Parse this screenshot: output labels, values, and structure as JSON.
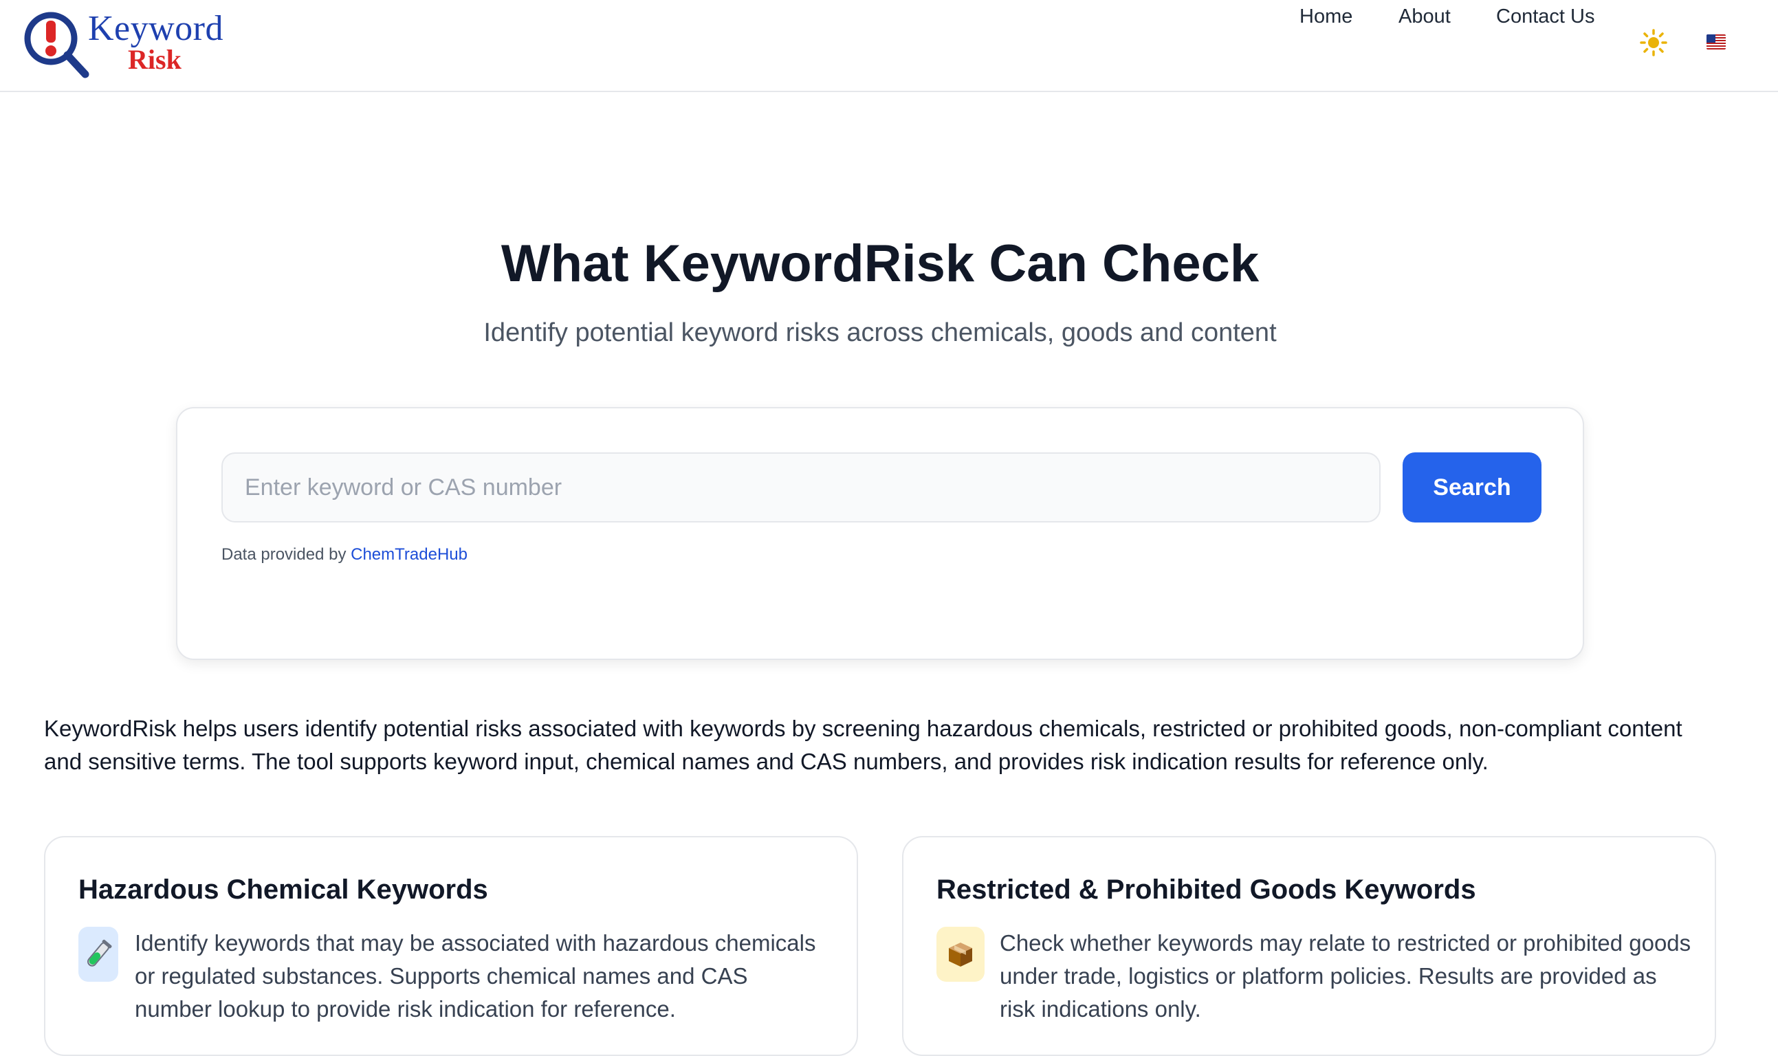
{
  "logo": {
    "line1": "Keyword",
    "line2": "Risk"
  },
  "nav": {
    "items": [
      "Home",
      "About",
      "Contact Us"
    ],
    "theme_icon": "sun-icon",
    "language_icon": "us-flag-icon"
  },
  "hero": {
    "title": "What KeywordRisk Can Check",
    "subtitle": "Identify potential keyword risks across chemicals, goods and content"
  },
  "search": {
    "placeholder": "Enter keyword or CAS number",
    "value": "",
    "button_label": "Search",
    "data_note_prefix": "Data provided by",
    "data_note_link": "ChemTradeHub"
  },
  "intro": "KeywordRisk helps users identify potential risks associated with keywords by screening hazardous chemicals, restricted or prohibited goods, non-compliant content and sensitive terms. The tool supports keyword input, chemical names and CAS numbers, and provides risk indication results for reference only.",
  "cards": [
    {
      "title": "Hazardous Chemical Keywords",
      "icon": "test-tube-icon",
      "text": "Identify keywords that may be associated with hazardous chemicals or regulated substances. Supports chemical names and CAS number lookup to provide risk indication for reference."
    },
    {
      "title": "Restricted & Prohibited Goods Keywords",
      "icon": "package-icon",
      "text": "Check whether keywords may relate to restricted or prohibited goods under trade, logistics or platform policies. Results are provided as risk indications only."
    }
  ],
  "colors": {
    "primary": "#2563eb",
    "logo_blue": "#1e40af",
    "logo_red": "#dc2626",
    "sun": "#eab308"
  }
}
